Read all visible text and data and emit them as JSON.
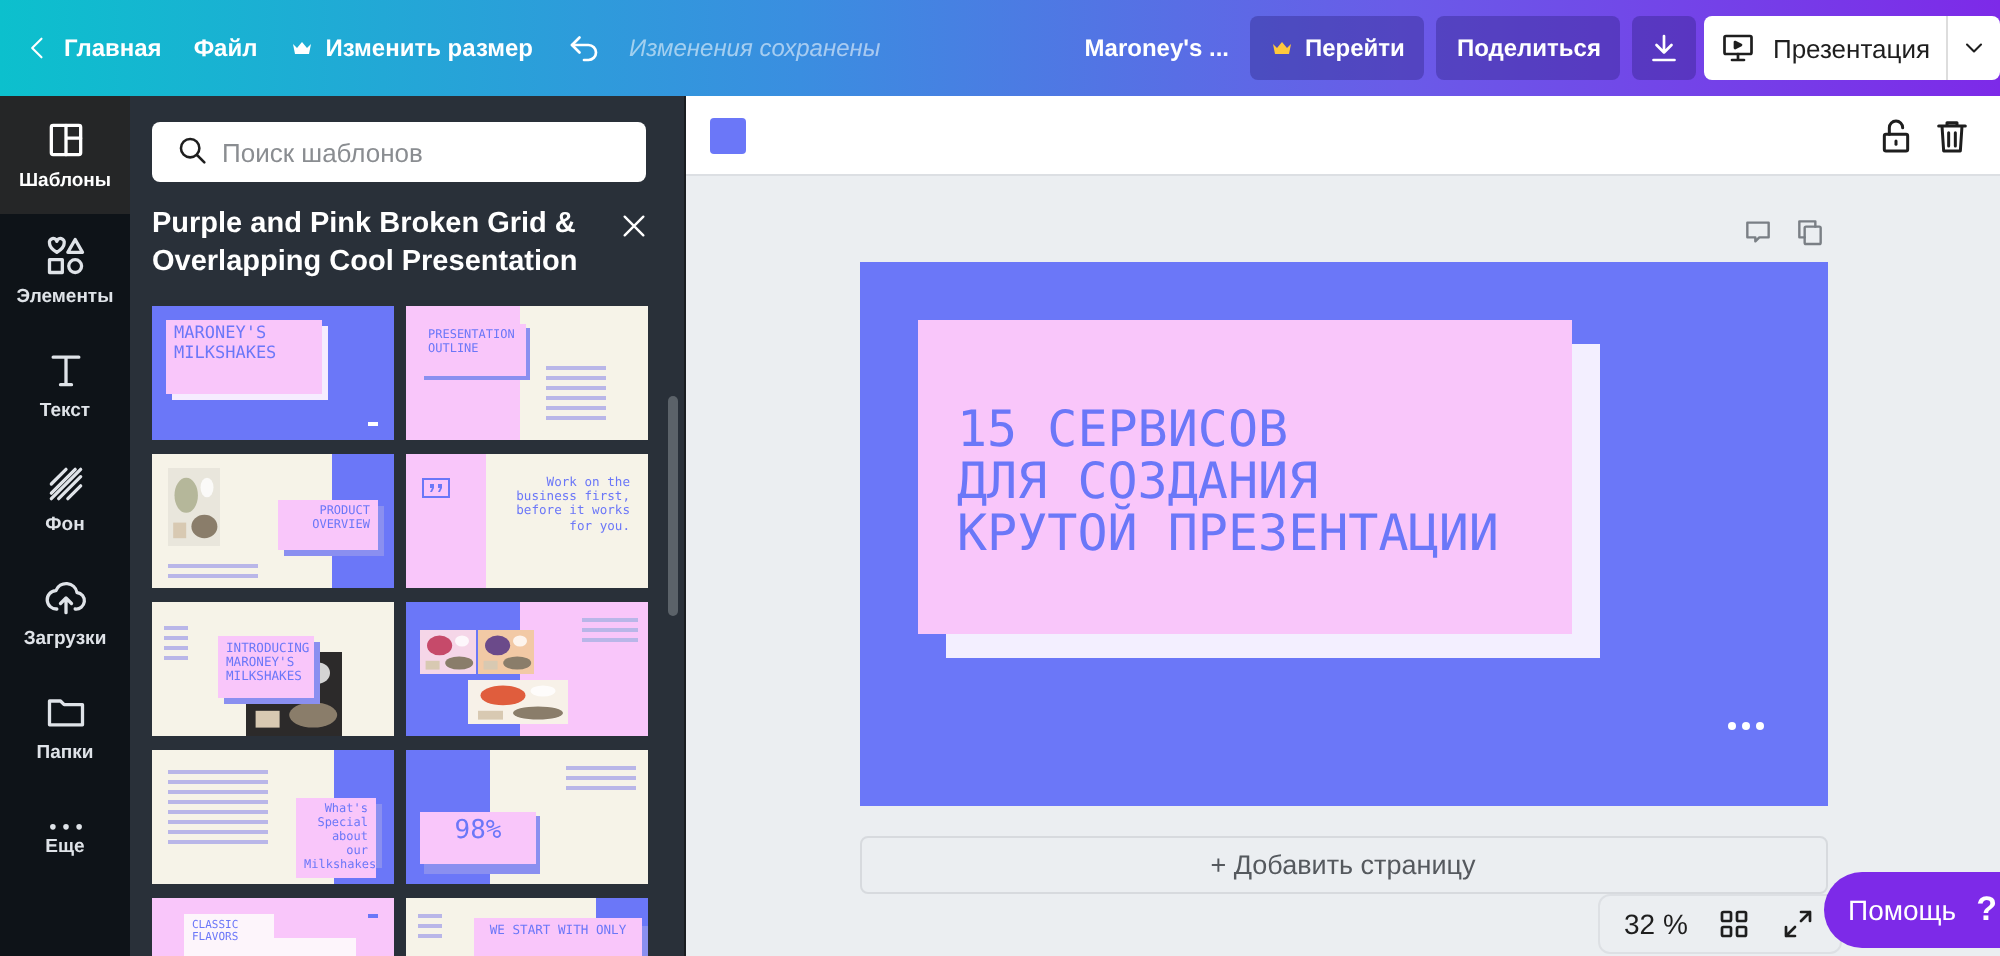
{
  "topbar": {
    "home": "Главная",
    "file": "Файл",
    "resize": "Изменить размер",
    "save_status": "Изменения сохранены",
    "doc_title": "Maroney's ...",
    "upgrade": "Перейти",
    "share": "Поделиться",
    "present": "Презентация"
  },
  "rail": [
    {
      "kind": "templates",
      "label": "Шаблоны",
      "selected": true
    },
    {
      "kind": "elements",
      "label": "Элементы",
      "selected": false
    },
    {
      "kind": "text",
      "label": "Текст",
      "selected": false
    },
    {
      "kind": "background",
      "label": "Фон",
      "selected": false
    },
    {
      "kind": "uploads",
      "label": "Загрузки",
      "selected": false
    },
    {
      "kind": "folders",
      "label": "Папки",
      "selected": false
    },
    {
      "kind": "more",
      "label": "Еще",
      "selected": false
    }
  ],
  "panel": {
    "search": {
      "placeholder": "Поиск шаблонов"
    },
    "title": "Purple and Pink Broken Grid & Overlapping Cool Presentation",
    "templates": [
      {
        "kind": "cover",
        "title": "MARONEY'S MILKSHAKES"
      },
      {
        "kind": "outline",
        "title": "PRESENTATION OUTLINE"
      },
      {
        "kind": "photo-box",
        "title": "PRODUCT OVERVIEW"
      },
      {
        "kind": "quote",
        "title": "Work on the business first, before it works for you."
      },
      {
        "kind": "intro",
        "title": "INTRODUCING MARONEY'S MILKSHAKES"
      },
      {
        "kind": "collage"
      },
      {
        "kind": "list-box",
        "title": "What's Special about our Milkshakes"
      },
      {
        "kind": "stat",
        "title": "98%"
      },
      {
        "kind": "flavors",
        "title": "CLASSIC FLAVORS"
      },
      {
        "kind": "start",
        "title": "WE START WITH ONLY"
      }
    ]
  },
  "editor": {
    "color": "#6b77f8",
    "slide": {
      "title_lines": [
        "15 СЕРВИСОВ",
        "ДЛЯ СОЗДАНИЯ",
        "КРУТОЙ ПРЕЗЕНТАЦИИ"
      ]
    },
    "add_page": "+ Добавить страницу",
    "zoom": "32 %",
    "help": "Помощь",
    "help_icon": "?"
  }
}
